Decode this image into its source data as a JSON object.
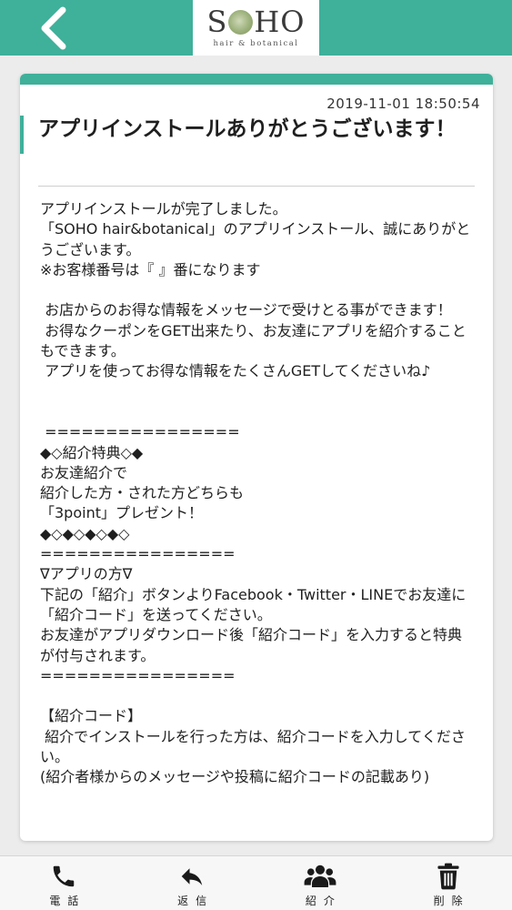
{
  "header": {
    "logo_main_1": "S",
    "logo_main_2": "HO",
    "logo_sub": "hair & botanical",
    "back_icon": "chevron-left-icon",
    "color": "#3fb09a"
  },
  "message": {
    "timestamp": "2019-11-01 18:50:54",
    "title": "アプリインストールありがとうございます！",
    "body": "アプリインストールが完了しました。\n「SOHO hair&botanical」のアプリインストール、誠にありがとうございます。\n※お客様番号は『 』番になります\n\n お店からのお得な情報をメッセージで受けとる事ができます！\n お得なクーポンをGET出来たり、お友達にアプリを紹介することもできます。\n アプリを使ってお得な情報をたくさんGETしてくださいね♪\n\n\n ================\n◆◇紹介特典◇◆\nお友達紹介で\n紹介した方・された方どちらも\n「3point」プレゼント！\n◆◇◆◇◆◇◆◇\n================\n∇アプリの方∇\n下記の「紹介」ボタンよりFacebook・Twitter・LINEでお友達に「紹介コード」を送ってください。\nお友達がアプリダウンロード後「紹介コード」を入力すると特典が付与されます。\n================\n\n【紹介コード】\n 紹介でインストールを行った方は、紹介コードを入力してください。\n(紹介者様からのメッセージや投稿に紹介コードの記載あり)"
  },
  "tabs": [
    {
      "label": "電話",
      "icon": "phone-icon"
    },
    {
      "label": "返信",
      "icon": "reply-icon"
    },
    {
      "label": "紹介",
      "icon": "users-icon"
    },
    {
      "label": "削除",
      "icon": "trash-icon"
    }
  ]
}
